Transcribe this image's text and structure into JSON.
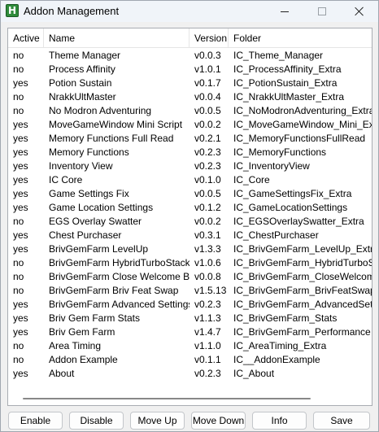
{
  "window": {
    "title": "Addon Management",
    "icon_letter": "H",
    "icon_color": "#2e8b3a"
  },
  "list": {
    "columns": [
      "Active",
      "Name",
      "Version",
      "Folder"
    ],
    "rows": [
      [
        "no",
        "Theme Manager",
        "v0.0.3",
        "IC_Theme_Manager"
      ],
      [
        "no",
        "Process Affinity",
        "v1.0.1",
        "IC_ProcessAffinity_Extra"
      ],
      [
        "yes",
        "Potion Sustain",
        "v0.1.7",
        "IC_PotionSustain_Extra"
      ],
      [
        "no",
        "NrakkUltMaster",
        "v0.0.4",
        "IC_NrakkUltMaster_Extra"
      ],
      [
        "no",
        "No Modron Adventuring",
        "v0.0.5",
        "IC_NoModronAdventuring_Extra"
      ],
      [
        "yes",
        "MoveGameWindow Mini Script",
        "v0.0.2",
        "IC_MoveGameWindow_Mini_Extra"
      ],
      [
        "yes",
        "Memory Functions Full Read",
        "v0.2.1",
        "IC_MemoryFunctionsFullRead"
      ],
      [
        "yes",
        "Memory Functions",
        "v0.2.3",
        "IC_MemoryFunctions"
      ],
      [
        "yes",
        "Inventory View",
        "v0.2.3",
        "IC_InventoryView"
      ],
      [
        "yes",
        "IC Core",
        "v0.1.0",
        "IC_Core"
      ],
      [
        "yes",
        "Game Settings Fix",
        "v0.0.5",
        "IC_GameSettingsFix_Extra"
      ],
      [
        "yes",
        "Game Location Settings",
        "v0.1.2",
        "IC_GameLocationSettings"
      ],
      [
        "no",
        "EGS Overlay Swatter",
        "v0.0.2",
        "IC_EGSOverlaySwatter_Extra"
      ],
      [
        "yes",
        "Chest Purchaser",
        "v0.3.1",
        "IC_ChestPurchaser"
      ],
      [
        "yes",
        "BrivGemFarm LevelUp",
        "v1.3.3",
        "IC_BrivGemFarm_LevelUp_Extra"
      ],
      [
        "no",
        "BrivGemFarm HybridTurboStacking",
        "v1.0.6",
        "IC_BrivGemFarm_HybridTurboStack"
      ],
      [
        "no",
        "BrivGemFarm Close Welcome Back",
        "v0.0.8",
        "IC_BrivGemFarm_CloseWelcomeBac"
      ],
      [
        "no",
        "BrivGemFarm Briv Feat Swap",
        "v1.5.13",
        "IC_BrivGemFarm_BrivFeatSwap_Ext"
      ],
      [
        "yes",
        "BrivGemFarm Advanced Settings",
        "v0.2.3",
        "IC_BrivGemFarm_AdvancedSettings"
      ],
      [
        "yes",
        "Briv Gem Farm Stats",
        "v1.1.3",
        "IC_BrivGemFarm_Stats"
      ],
      [
        "yes",
        "Briv Gem Farm",
        "v1.4.7",
        "IC_BrivGemFarm_Performance"
      ],
      [
        "no",
        "Area Timing",
        "v1.1.0",
        "IC_AreaTiming_Extra"
      ],
      [
        "no",
        "Addon Example",
        "v0.1.1",
        "IC__AddonExample"
      ],
      [
        "yes",
        "About",
        "v0.2.3",
        "IC_About"
      ]
    ]
  },
  "buttons": {
    "enable": "Enable",
    "disable": "Disable",
    "move_up": "Move Up",
    "move_down": "Move Down",
    "info": "Info",
    "save": "Save"
  }
}
